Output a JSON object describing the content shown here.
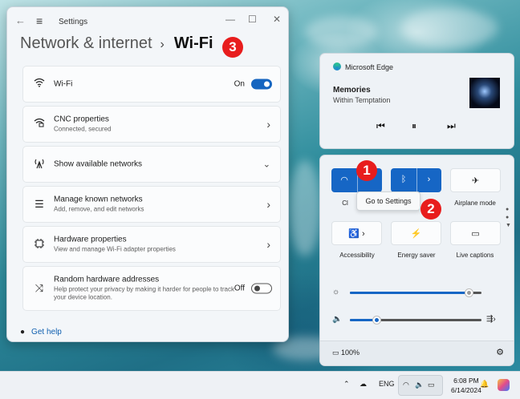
{
  "settings": {
    "window_title": "Settings",
    "breadcrumb_parent": "Network & internet",
    "breadcrumb_sep": "›",
    "breadcrumb_current": "Wi-Fi",
    "items": [
      {
        "title": "Wi-Fi",
        "subtitle": "",
        "state": "On",
        "control": "toggle-on",
        "icon": "wifi-icon"
      },
      {
        "title": "CNC properties",
        "subtitle": "Connected, secured",
        "control": "chevron-right",
        "icon": "secured-wifi-icon"
      },
      {
        "title": "Show available networks",
        "subtitle": "",
        "control": "chevron-down",
        "icon": "antenna-icon"
      },
      {
        "title": "Manage known networks",
        "subtitle": "Add, remove, and edit networks",
        "control": "chevron-right",
        "icon": "list-icon"
      },
      {
        "title": "Hardware properties",
        "subtitle": "View and manage Wi-Fi adapter properties",
        "control": "chevron-right",
        "icon": "chip-icon"
      },
      {
        "title": "Random hardware addresses",
        "subtitle": "Help protect your privacy by making it harder for people to track your device location.",
        "state": "Off",
        "control": "toggle-off",
        "icon": "shuffle-icon"
      }
    ],
    "get_help": "Get help"
  },
  "badges": {
    "one": "1",
    "two": "2",
    "three": "3"
  },
  "media": {
    "app": "Microsoft Edge",
    "song": "Memories",
    "artist": "Within Temptation"
  },
  "quick_settings": {
    "wifi_label_partial": "Cl",
    "airplane_label": "Airplane mode",
    "accessibility_label": "Accessibility",
    "energy_label": "Energy saver",
    "captions_label": "Live captions",
    "tooltip": "Go to Settings",
    "battery": "100%",
    "brightness": 0.9,
    "volume": 0.2
  },
  "taskbar": {
    "language": "ENG",
    "time": "6:08 PM",
    "date": "6/14/2024"
  },
  "colors": {
    "accent": "#1666c5",
    "badge": "#e81d1d"
  }
}
